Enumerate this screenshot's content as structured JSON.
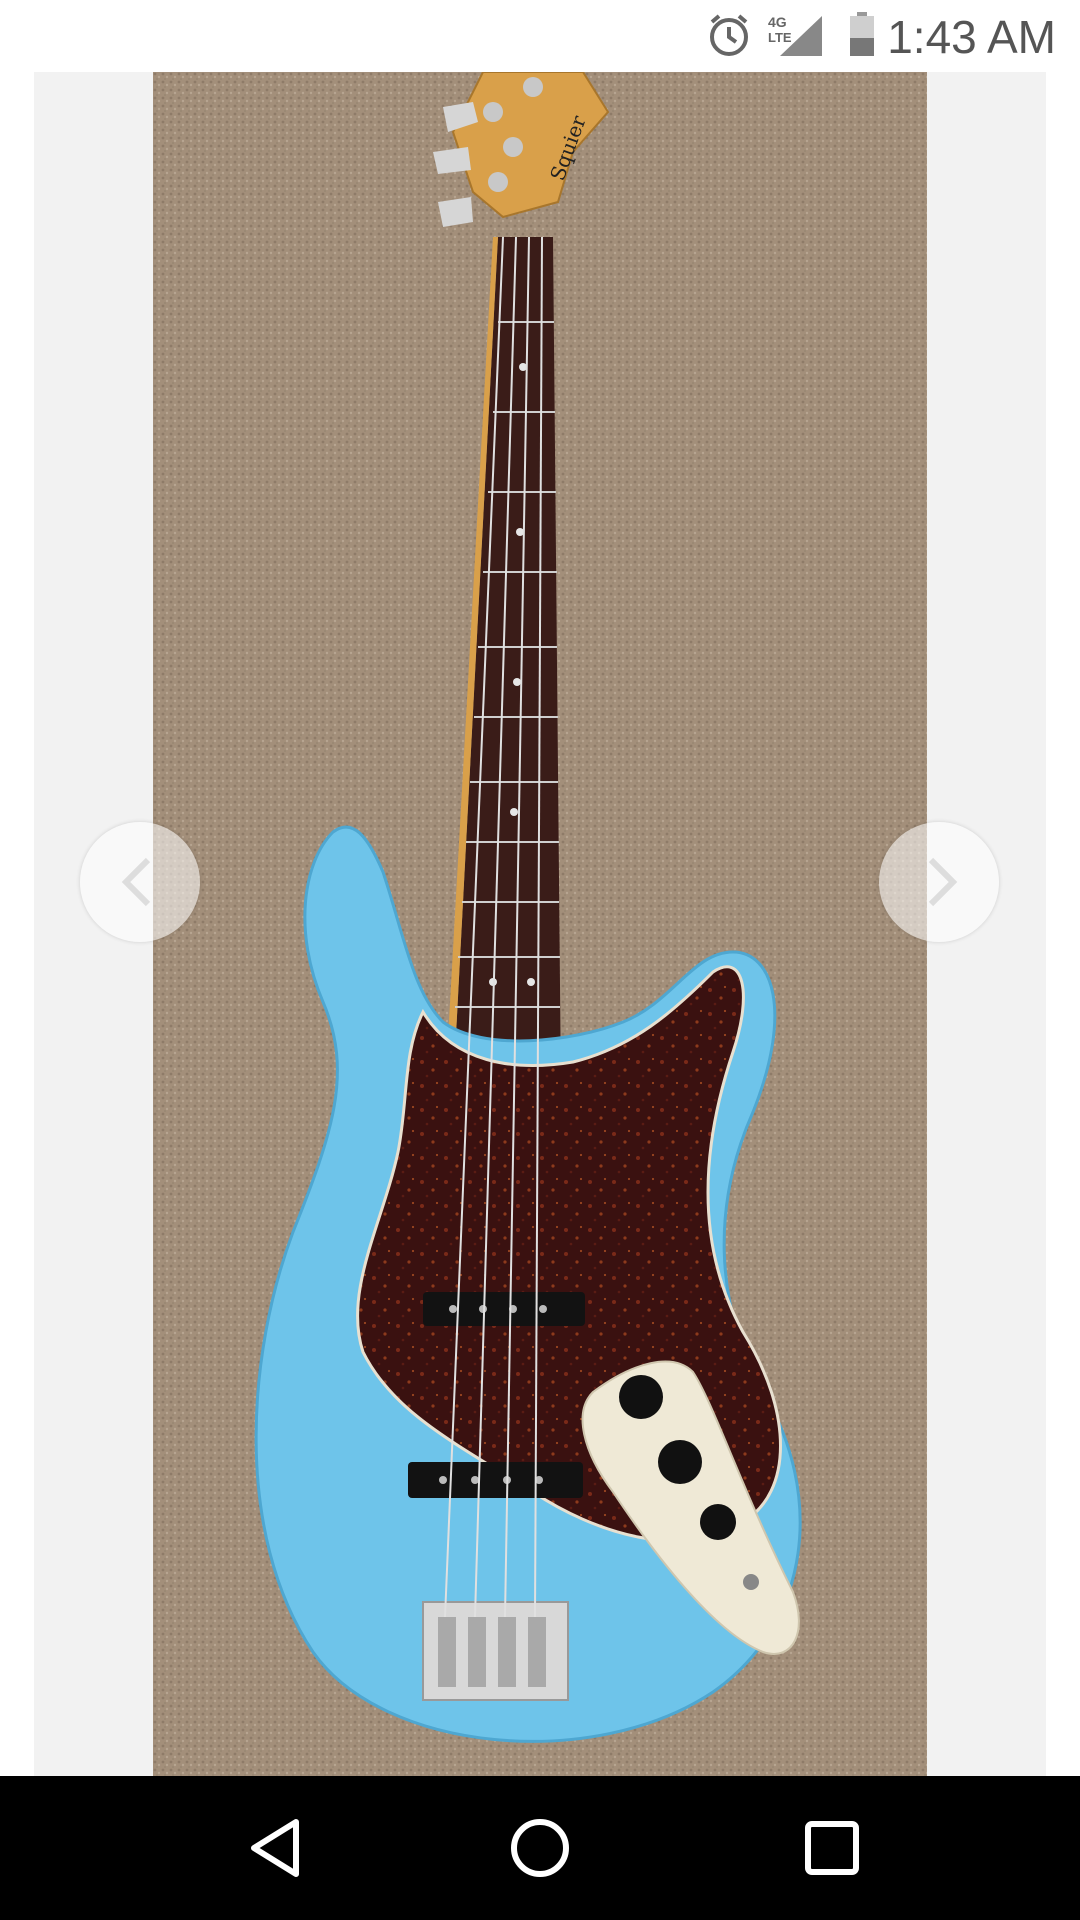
{
  "status_bar": {
    "time": "1:43 AM",
    "network": "4G LTE",
    "icons": [
      "alarm-icon",
      "signal-icon",
      "battery-icon"
    ]
  },
  "gallery": {
    "image_subject": "light-blue bass guitar on carpet",
    "nav": {
      "previous_icon": "chevron-left-icon",
      "next_icon": "chevron-right-icon"
    }
  },
  "nav_bar": {
    "icons": [
      "back-icon",
      "home-icon",
      "recents-icon"
    ]
  },
  "colors": {
    "status_text": "#555555",
    "gallery_bg": "#f2f2f2",
    "guitar_body": "#6ec4ea",
    "carpet": "#a08f7c",
    "nav_bar": "#000000"
  }
}
